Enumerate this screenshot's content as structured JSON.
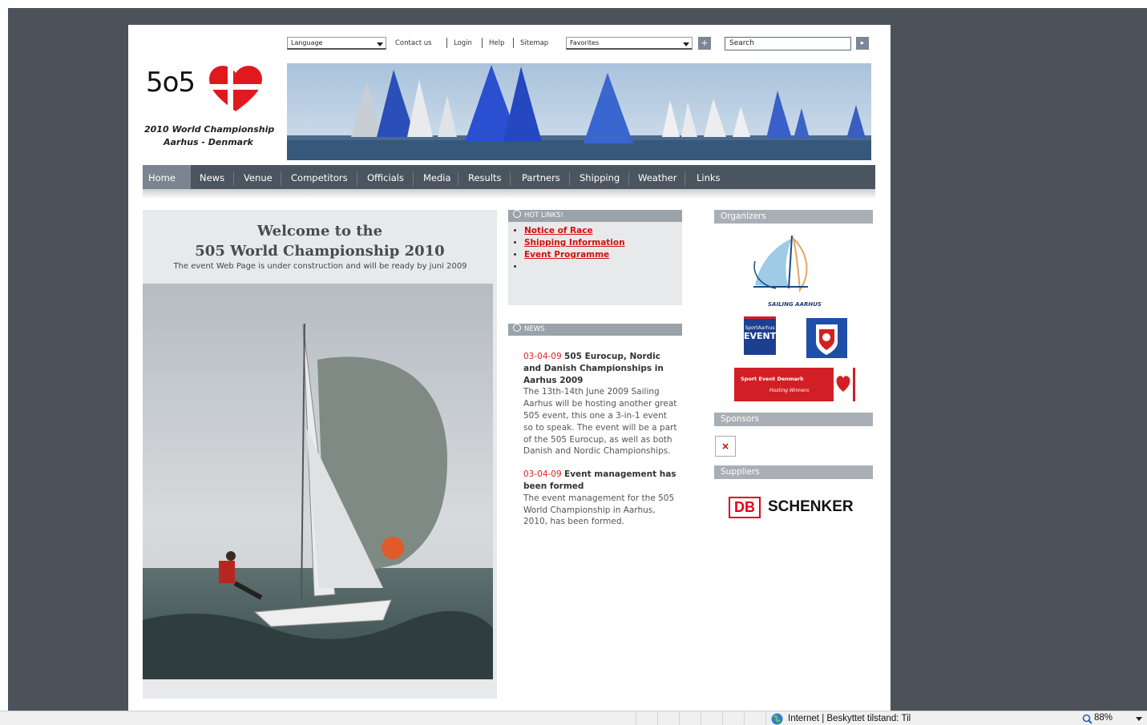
{
  "topbar": {
    "language_select": "Language",
    "links": [
      "Contact us",
      "Login",
      "Help",
      "Sitemap"
    ],
    "favorites_select": "Favorites",
    "add_button": "+",
    "search_placeholder": "Search",
    "go_button": "▸"
  },
  "logo": {
    "number": "5o5",
    "line1": "2010 World Championship",
    "line2": "Aarhus - Denmark"
  },
  "nav": {
    "items": [
      "Home",
      "News",
      "Venue",
      "Competitors",
      "Officials",
      "Media",
      "Results",
      "Partners",
      "Shipping",
      "Weather",
      "Links"
    ],
    "active": "Home"
  },
  "welcome": {
    "title_line1": "Welcome to the",
    "title_line2": "505 World Championship 2010",
    "subtitle": "The event Web Page is under construction and will be ready by juni 2009"
  },
  "hotlinks": {
    "header": "HOT LINKS!",
    "items": [
      "Notice of Race ",
      "Shipping Information ",
      "Event Programme "
    ]
  },
  "news": {
    "header": "NEWS",
    "items": [
      {
        "date": "03-04-09",
        "title": "505 Eurocup, Nordic and Danish Championships in Aarhus 2009",
        "body": "The 13th-14th June 2009 Sailing Aarhus will be hosting another great 505 event, this one a 3-in-1 event so to speak. The event will be a part of the 505 Eurocup, as well as both Danish and Nordic Championships."
      },
      {
        "date": "03-04-09",
        "title": "Event management has been formed",
        "body": "The event management for the 505 World Championship in Aarhus, 2010, has been formed."
      }
    ]
  },
  "sidebar": {
    "organizers_header": "Organizers",
    "sailing_aarhus": "SAILING AARHUS",
    "sport_aarhus_line1": "SportAarhus",
    "sport_aarhus_line2": "EVENTS",
    "sport_event_denmark_line1": "Sport Event Denmark",
    "sport_event_denmark_line2": "Hosting Winners",
    "sponsors_header": "Sponsors",
    "broken_image": "×",
    "suppliers_header": "Suppliers",
    "db_logo": "DB",
    "schenker": "SCHENKER"
  },
  "statusbar": {
    "zone": "Internet | Beskyttet tilstand: Til",
    "zoom": "88%"
  },
  "colors": {
    "nav_bg": "#4b555f",
    "nav_active": "#7a8591",
    "hotlink_red": "#d41010",
    "backdrop": "#4b525a"
  }
}
